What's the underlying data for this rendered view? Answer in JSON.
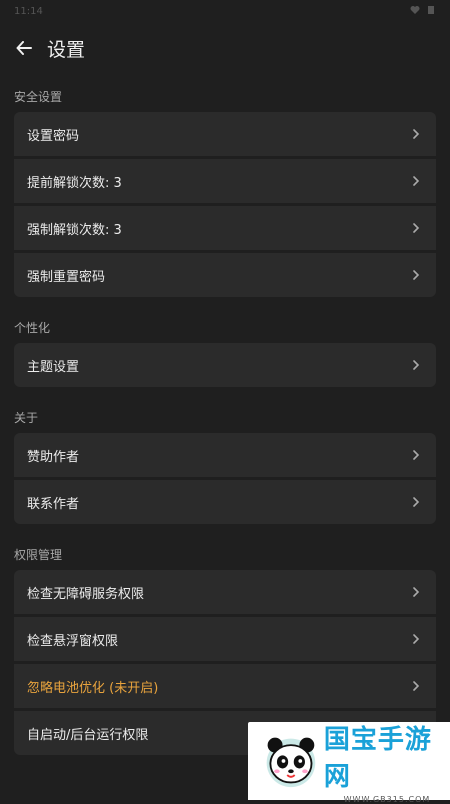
{
  "status": {
    "time": "11:14"
  },
  "app_bar": {
    "title": "设置"
  },
  "sections": [
    {
      "header": "安全设置",
      "items": [
        {
          "label": "设置密码"
        },
        {
          "label": "提前解锁次数: 3"
        },
        {
          "label": "强制解锁次数: 3"
        },
        {
          "label": "强制重置密码"
        }
      ]
    },
    {
      "header": "个性化",
      "items": [
        {
          "label": "主题设置"
        }
      ]
    },
    {
      "header": "关于",
      "items": [
        {
          "label": "赞助作者"
        },
        {
          "label": "联系作者"
        }
      ]
    },
    {
      "header": "权限管理",
      "items": [
        {
          "label": "检查无障碍服务权限"
        },
        {
          "label": "检查悬浮窗权限"
        },
        {
          "label": "忽略电池优化 (未开启)"
        },
        {
          "label": "自启动/后台运行权限"
        }
      ]
    }
  ],
  "watermark": {
    "name": "国宝手游网",
    "url": "WWW.GB315.COM"
  },
  "colors": {
    "background": "#1f1f1f",
    "card": "#2b2b2b",
    "warning": "#e8a33d",
    "watermark_text": "#1aa1d8"
  }
}
